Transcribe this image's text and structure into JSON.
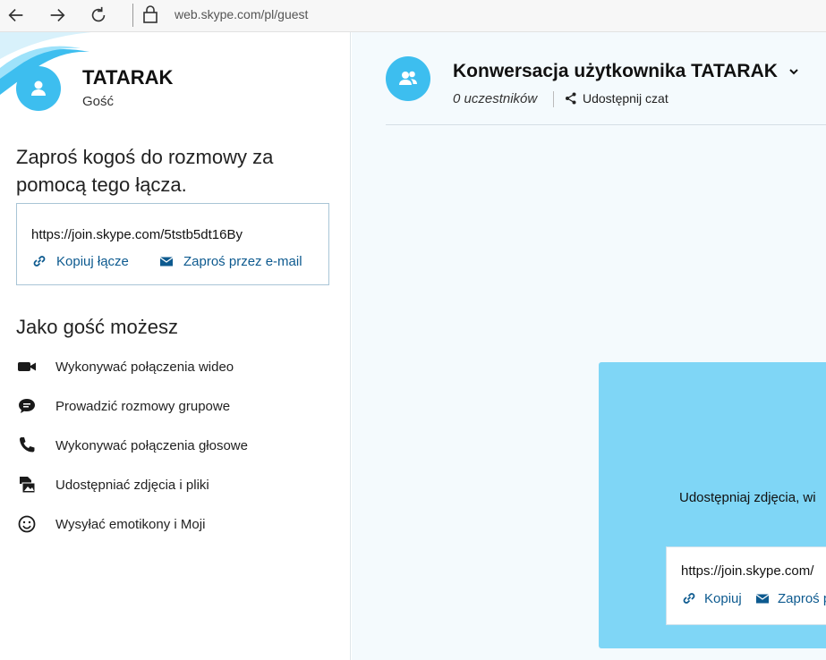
{
  "browser": {
    "url": "web.skype.com/pl/guest"
  },
  "sidebar": {
    "user_name": "TATARAK",
    "user_role": "Gość",
    "invite_title": "Zaproś kogoś do rozmowy za pomocą tego łącza.",
    "invite_link": "https://join.skype.com/5tstb5dt16By",
    "copy_link_label": "Kopiuj łącze",
    "email_invite_label": "Zaproś przez e-mail",
    "guest_title": "Jako gość możesz",
    "features": [
      {
        "icon": "video-camera-icon",
        "label": "Wykonywać połączenia wideo"
      },
      {
        "icon": "chat-bubble-icon",
        "label": "Prowadzić rozmowy grupowe"
      },
      {
        "icon": "phone-icon",
        "label": "Wykonywać połączenia głosowe"
      },
      {
        "icon": "photo-file-icon",
        "label": "Udostępniać zdjęcia i pliki"
      },
      {
        "icon": "smiley-icon",
        "label": "Wysyłać emotikony i Moji"
      }
    ]
  },
  "conversation": {
    "title": "Konwersacja użytkownika TATARAK",
    "participants": "0 uczestników",
    "share_label": "Udostępnij czat"
  },
  "card": {
    "text": "Udostępniaj zdjęcia, wi",
    "link": "https://join.skype.com/",
    "copy_label": "Kopiuj",
    "invite_label": "Zaproś p"
  },
  "colors": {
    "accent": "#3dbeef",
    "link": "#0d5a8f",
    "card_bg": "#7fd6f6"
  }
}
